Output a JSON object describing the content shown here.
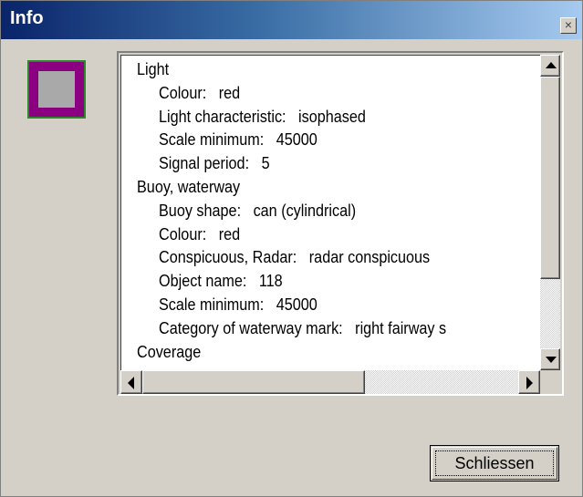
{
  "window": {
    "title": "Info",
    "close_glyph": "×",
    "swatch_colors": {
      "border": "#8b0080",
      "fill": "#aaa9a9",
      "outline": "#2a8a2a"
    }
  },
  "info_list": {
    "lines": [
      {
        "text": "Light",
        "indent": 0
      },
      {
        "text": "Colour:   red",
        "indent": 1
      },
      {
        "text": "Light characteristic:   isophased",
        "indent": 1
      },
      {
        "text": "Scale minimum:   45000",
        "indent": 1
      },
      {
        "text": "Signal period:   5",
        "indent": 1
      },
      {
        "text": "Buoy, waterway",
        "indent": 0
      },
      {
        "text": "Buoy shape:   can (cylindrical)",
        "indent": 1
      },
      {
        "text": "Colour:   red",
        "indent": 1
      },
      {
        "text": "Conspicuous, Radar:   radar conspicuous",
        "indent": 1
      },
      {
        "text": "Object name:   118",
        "indent": 1
      },
      {
        "text": "Scale minimum:   45000",
        "indent": 1
      },
      {
        "text": "Category of waterway mark:   right fairway s",
        "indent": 1
      },
      {
        "text": "Coverage",
        "indent": 0
      }
    ]
  },
  "buttons": {
    "close_label": "Schliessen"
  },
  "icons": {
    "scroll_up": "arrow-up-icon",
    "scroll_down": "arrow-down-icon",
    "scroll_left": "arrow-left-icon",
    "scroll_right": "arrow-right-icon",
    "close": "close-icon"
  }
}
